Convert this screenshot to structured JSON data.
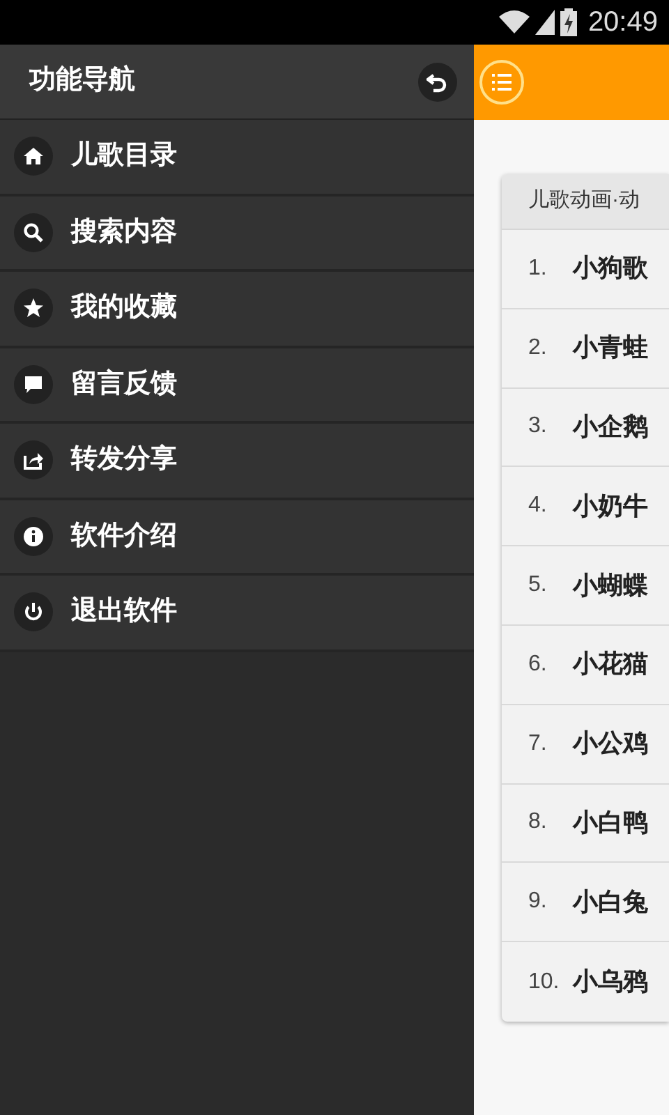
{
  "status_bar": {
    "time": "20:49"
  },
  "drawer": {
    "title": "功能导航",
    "items": [
      {
        "label": "儿歌目录"
      },
      {
        "label": "搜索内容"
      },
      {
        "label": "我的收藏"
      },
      {
        "label": "留言反馈"
      },
      {
        "label": "转发分享"
      },
      {
        "label": "软件介绍"
      },
      {
        "label": "退出软件"
      }
    ]
  },
  "list": {
    "header": "儿歌动画·动",
    "rows": [
      {
        "number": "1.",
        "title": "小狗歌"
      },
      {
        "number": "2.",
        "title": "小青蛙"
      },
      {
        "number": "3.",
        "title": "小企鹅"
      },
      {
        "number": "4.",
        "title": "小奶牛"
      },
      {
        "number": "5.",
        "title": "小蝴蝶"
      },
      {
        "number": "6.",
        "title": "小花猫"
      },
      {
        "number": "7.",
        "title": "小公鸡"
      },
      {
        "number": "8.",
        "title": "小白鸭"
      },
      {
        "number": "9.",
        "title": "小白兔"
      },
      {
        "number": "10.",
        "title": "小乌鸦"
      }
    ]
  }
}
